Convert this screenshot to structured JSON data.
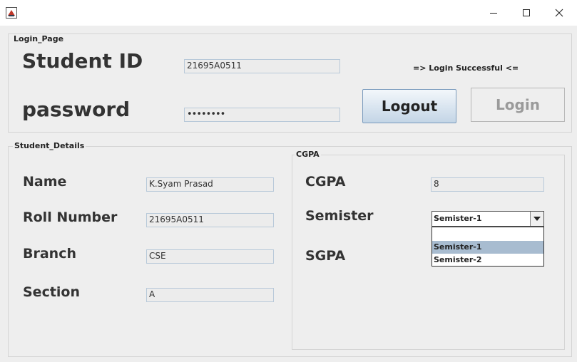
{
  "window": {
    "title": "",
    "controls": {
      "minimize": "minimize-icon",
      "maximize": "maximize-icon",
      "close": "close-icon"
    }
  },
  "login_panel": {
    "legend": "Login_Page",
    "student_id_label": "Student ID",
    "student_id_value": "21695A0511",
    "password_label": "password",
    "password_value": "••••••••",
    "status": "=> Login Successful <=",
    "logout_label": "Logout",
    "login_label": "Login"
  },
  "details_panel": {
    "legend": "Student_Details",
    "name_label": "Name",
    "name_value": "K.Syam Prasad",
    "roll_label": "Roll Number",
    "roll_value": "21695A0511",
    "branch_label": "Branch",
    "branch_value": "CSE",
    "section_label": "Section",
    "section_value": "A"
  },
  "cgpa_panel": {
    "legend": "CGPA",
    "cgpa_label": "CGPA",
    "cgpa_value": "8",
    "semister_label": "Semister",
    "semister_selected": "Semister-1",
    "semister_options": [
      "",
      "Semister-1",
      "Semister-2"
    ],
    "sgpa_label": "SGPA"
  },
  "colors": {
    "logout_button_top": "#f3f7fb",
    "logout_button_bottom": "#c3d5e6",
    "selected_option": "#a8bcd0",
    "field_border": "#b8c9d9"
  }
}
